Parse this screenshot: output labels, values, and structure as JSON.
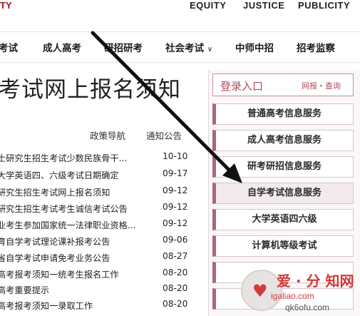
{
  "header": {
    "logo_fragment": "TY",
    "motto": [
      "EQUITY",
      "JUSTICE",
      "PUBLICITY"
    ]
  },
  "nav": {
    "items": [
      "考试",
      "成人高考",
      "研招研考",
      "社会考试",
      "中师中招",
      "招考监察"
    ],
    "dropdown_chevron": "∨"
  },
  "page": {
    "title": "考试网上报名须知"
  },
  "tabs": [
    "政策导航",
    "通知公告"
  ],
  "news": [
    {
      "title": "士研究生招生考试少数民族骨干...",
      "date": "10-10"
    },
    {
      "title": "大学英语四、六级考试日期确定",
      "date": "09-17"
    },
    {
      "title": "研究生招生考试网上报名须知",
      "date": "09-12"
    },
    {
      "title": "研究生招生考试考生诚信考试公告",
      "date": "09-12"
    },
    {
      "title": "业考生参加国家统一法律职业资格...",
      "date": "09-12"
    },
    {
      "title": "育自学考试理论课补报考公告",
      "date": "09-06"
    },
    {
      "title": "省自学考试申请免考业务公告",
      "date": "08-27"
    },
    {
      "title": "高考报考须知一统考生报名工作",
      "date": "08-20"
    },
    {
      "title": "高考重要提示",
      "date": "08-20"
    },
    {
      "title": "高考报考须知一录取工作",
      "date": "08-20"
    }
  ],
  "sidebar": {
    "login_title": "登录入口",
    "login_sub": "网报・查询",
    "services": [
      "普通高考信息服务",
      "成人高考信息服务",
      "研考研招信息服务",
      "自学考试信息服务",
      "大学英语四六级",
      "计算机等级考试"
    ]
  },
  "watermark": {
    "text": "爱 · 分 知网",
    "url": "igaliao.com",
    "url2": "qk6ofu.com"
  },
  "colors": {
    "brand_red": "#a3191f",
    "sidebar_accent": "#a9677a",
    "login_text": "#b44a5a"
  }
}
